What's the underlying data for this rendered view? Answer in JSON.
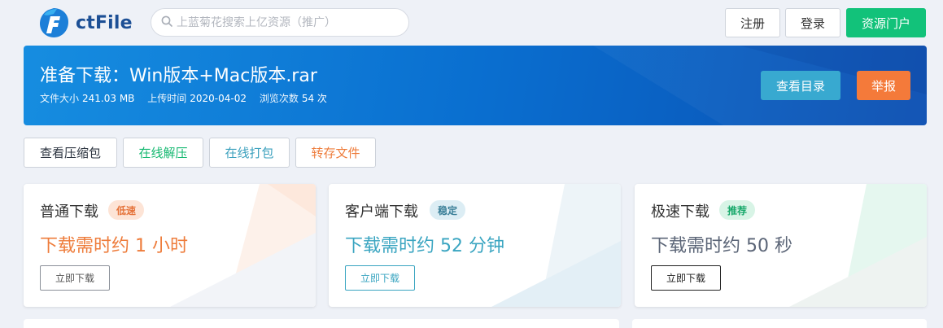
{
  "header": {
    "logo_text": "ctFile",
    "search_placeholder": "上蓝菊花搜索上亿资源（推广）",
    "register_label": "注册",
    "login_label": "登录",
    "portal_label": "资源门户"
  },
  "banner": {
    "title": "准备下载：Win版本+Mac版本.rar",
    "size_label": "文件大小",
    "size_value": "241.03 MB",
    "upload_label": "上传时间",
    "upload_value": "2020-04-02",
    "views_label": "浏览次数",
    "views_value": "54 次",
    "catalog_label": "查看目录",
    "report_label": "举报"
  },
  "tools": {
    "view_archive": "查看压缩包",
    "online_extract": "在线解压",
    "online_pack": "在线打包",
    "save_file": "转存文件"
  },
  "cards": [
    {
      "title": "普通下载",
      "badge": "低速",
      "eta": "下载需时约 1 小时",
      "button": "立即下载"
    },
    {
      "title": "客户端下载",
      "badge": "稳定",
      "eta": "下载需时约 52 分钟",
      "button": "立即下载"
    },
    {
      "title": "极速下载",
      "badge": "推荐",
      "eta": "下载需时约 50 秒",
      "button": "立即下载"
    }
  ],
  "colors": {
    "accent_green": "#12c27a",
    "orange": "#f47a3a",
    "teal": "#38a9d0",
    "banner_blue": "#0a6fd0",
    "slow_orange": "#ee7c3b",
    "stable_teal": "#3aa5c1",
    "fast_gray": "#5b6577"
  },
  "icons": {
    "logo": "ctfile-logo-icon",
    "search": "search-icon"
  }
}
